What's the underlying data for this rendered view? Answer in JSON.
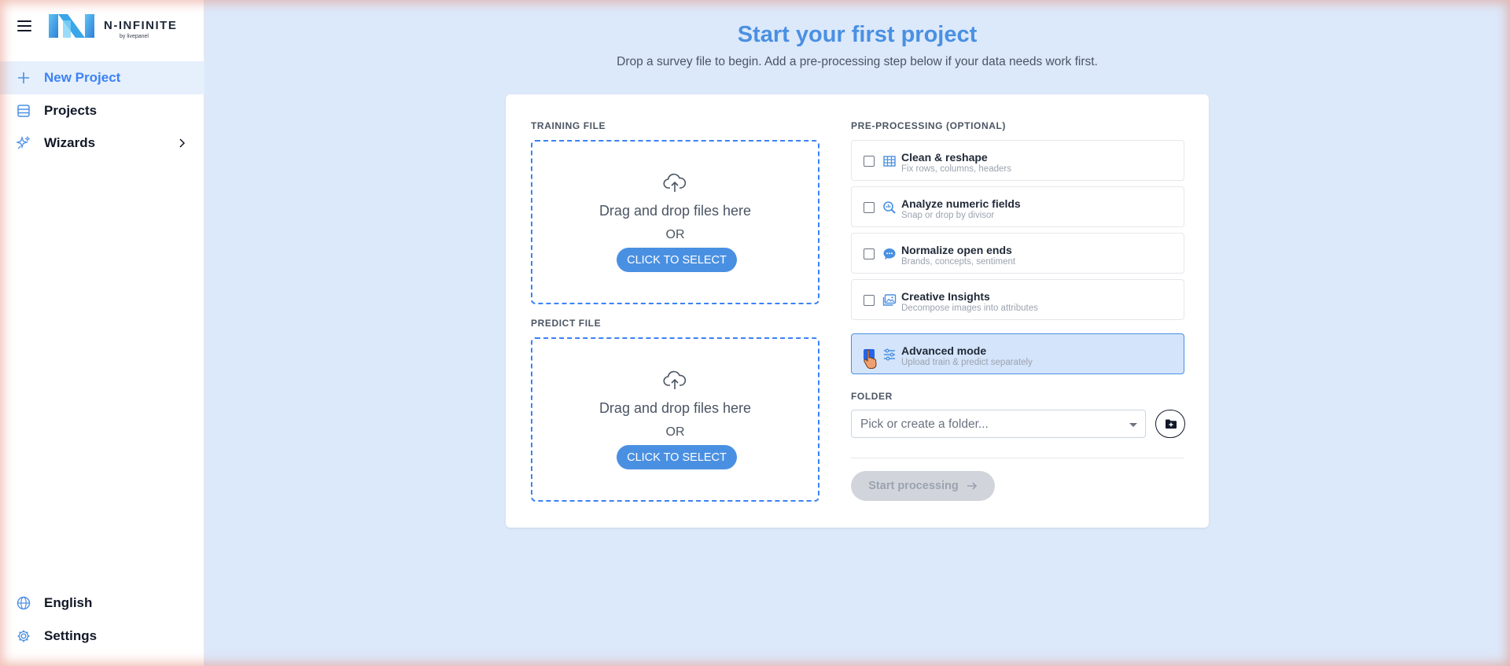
{
  "app": {
    "brand_name": "N-INFINITE",
    "brand_sub": "by livepanel"
  },
  "sidebar": {
    "items": [
      {
        "label": "New Project",
        "icon": "plus-icon",
        "active": true
      },
      {
        "label": "Projects",
        "icon": "list-icon"
      },
      {
        "label": "Wizards",
        "icon": "sparkles-icon",
        "expandable": true
      }
    ],
    "bottom_items": [
      {
        "label": "English",
        "icon": "globe-icon"
      },
      {
        "label": "Settings",
        "icon": "gear-icon"
      }
    ]
  },
  "main": {
    "title": "Start your first project",
    "subtitle": "Drop a survey file to begin. Add a pre-processing step below if your data needs work first.",
    "training": {
      "label": "TRAINING FILE",
      "drop_text": "Drag and drop files here",
      "or_text": "OR",
      "button_label": "CLICK TO SELECT"
    },
    "predict": {
      "label": "PREDICT FILE",
      "drop_text": "Drag and drop files here",
      "or_text": "OR",
      "button_label": "CLICK TO SELECT"
    },
    "preprocessing": {
      "label": "PRE-PROCESSING (OPTIONAL)",
      "options": [
        {
          "title": "Clean & reshape",
          "desc": "Fix rows, columns, headers",
          "icon": "grid-icon",
          "checked": false
        },
        {
          "title": "Analyze numeric fields",
          "desc": "Snap or drop by divisor",
          "icon": "chart-search-icon",
          "checked": false
        },
        {
          "title": "Normalize open ends",
          "desc": "Brands, concepts, sentiment",
          "icon": "chat-bubble-icon",
          "checked": false
        },
        {
          "title": "Creative Insights",
          "desc": "Decompose images into attributes",
          "icon": "images-icon",
          "checked": false
        },
        {
          "title": "Advanced mode",
          "desc": "Upload train & predict separately",
          "icon": "sliders-icon",
          "checked": true
        }
      ]
    },
    "folder": {
      "label": "FOLDER",
      "placeholder": "Pick or create a folder..."
    },
    "start_button": {
      "label": "Start processing"
    },
    "colors": {
      "accent": "#4a90e2",
      "background": "#dce9fb",
      "selected_option": "#d4e4fa"
    }
  }
}
